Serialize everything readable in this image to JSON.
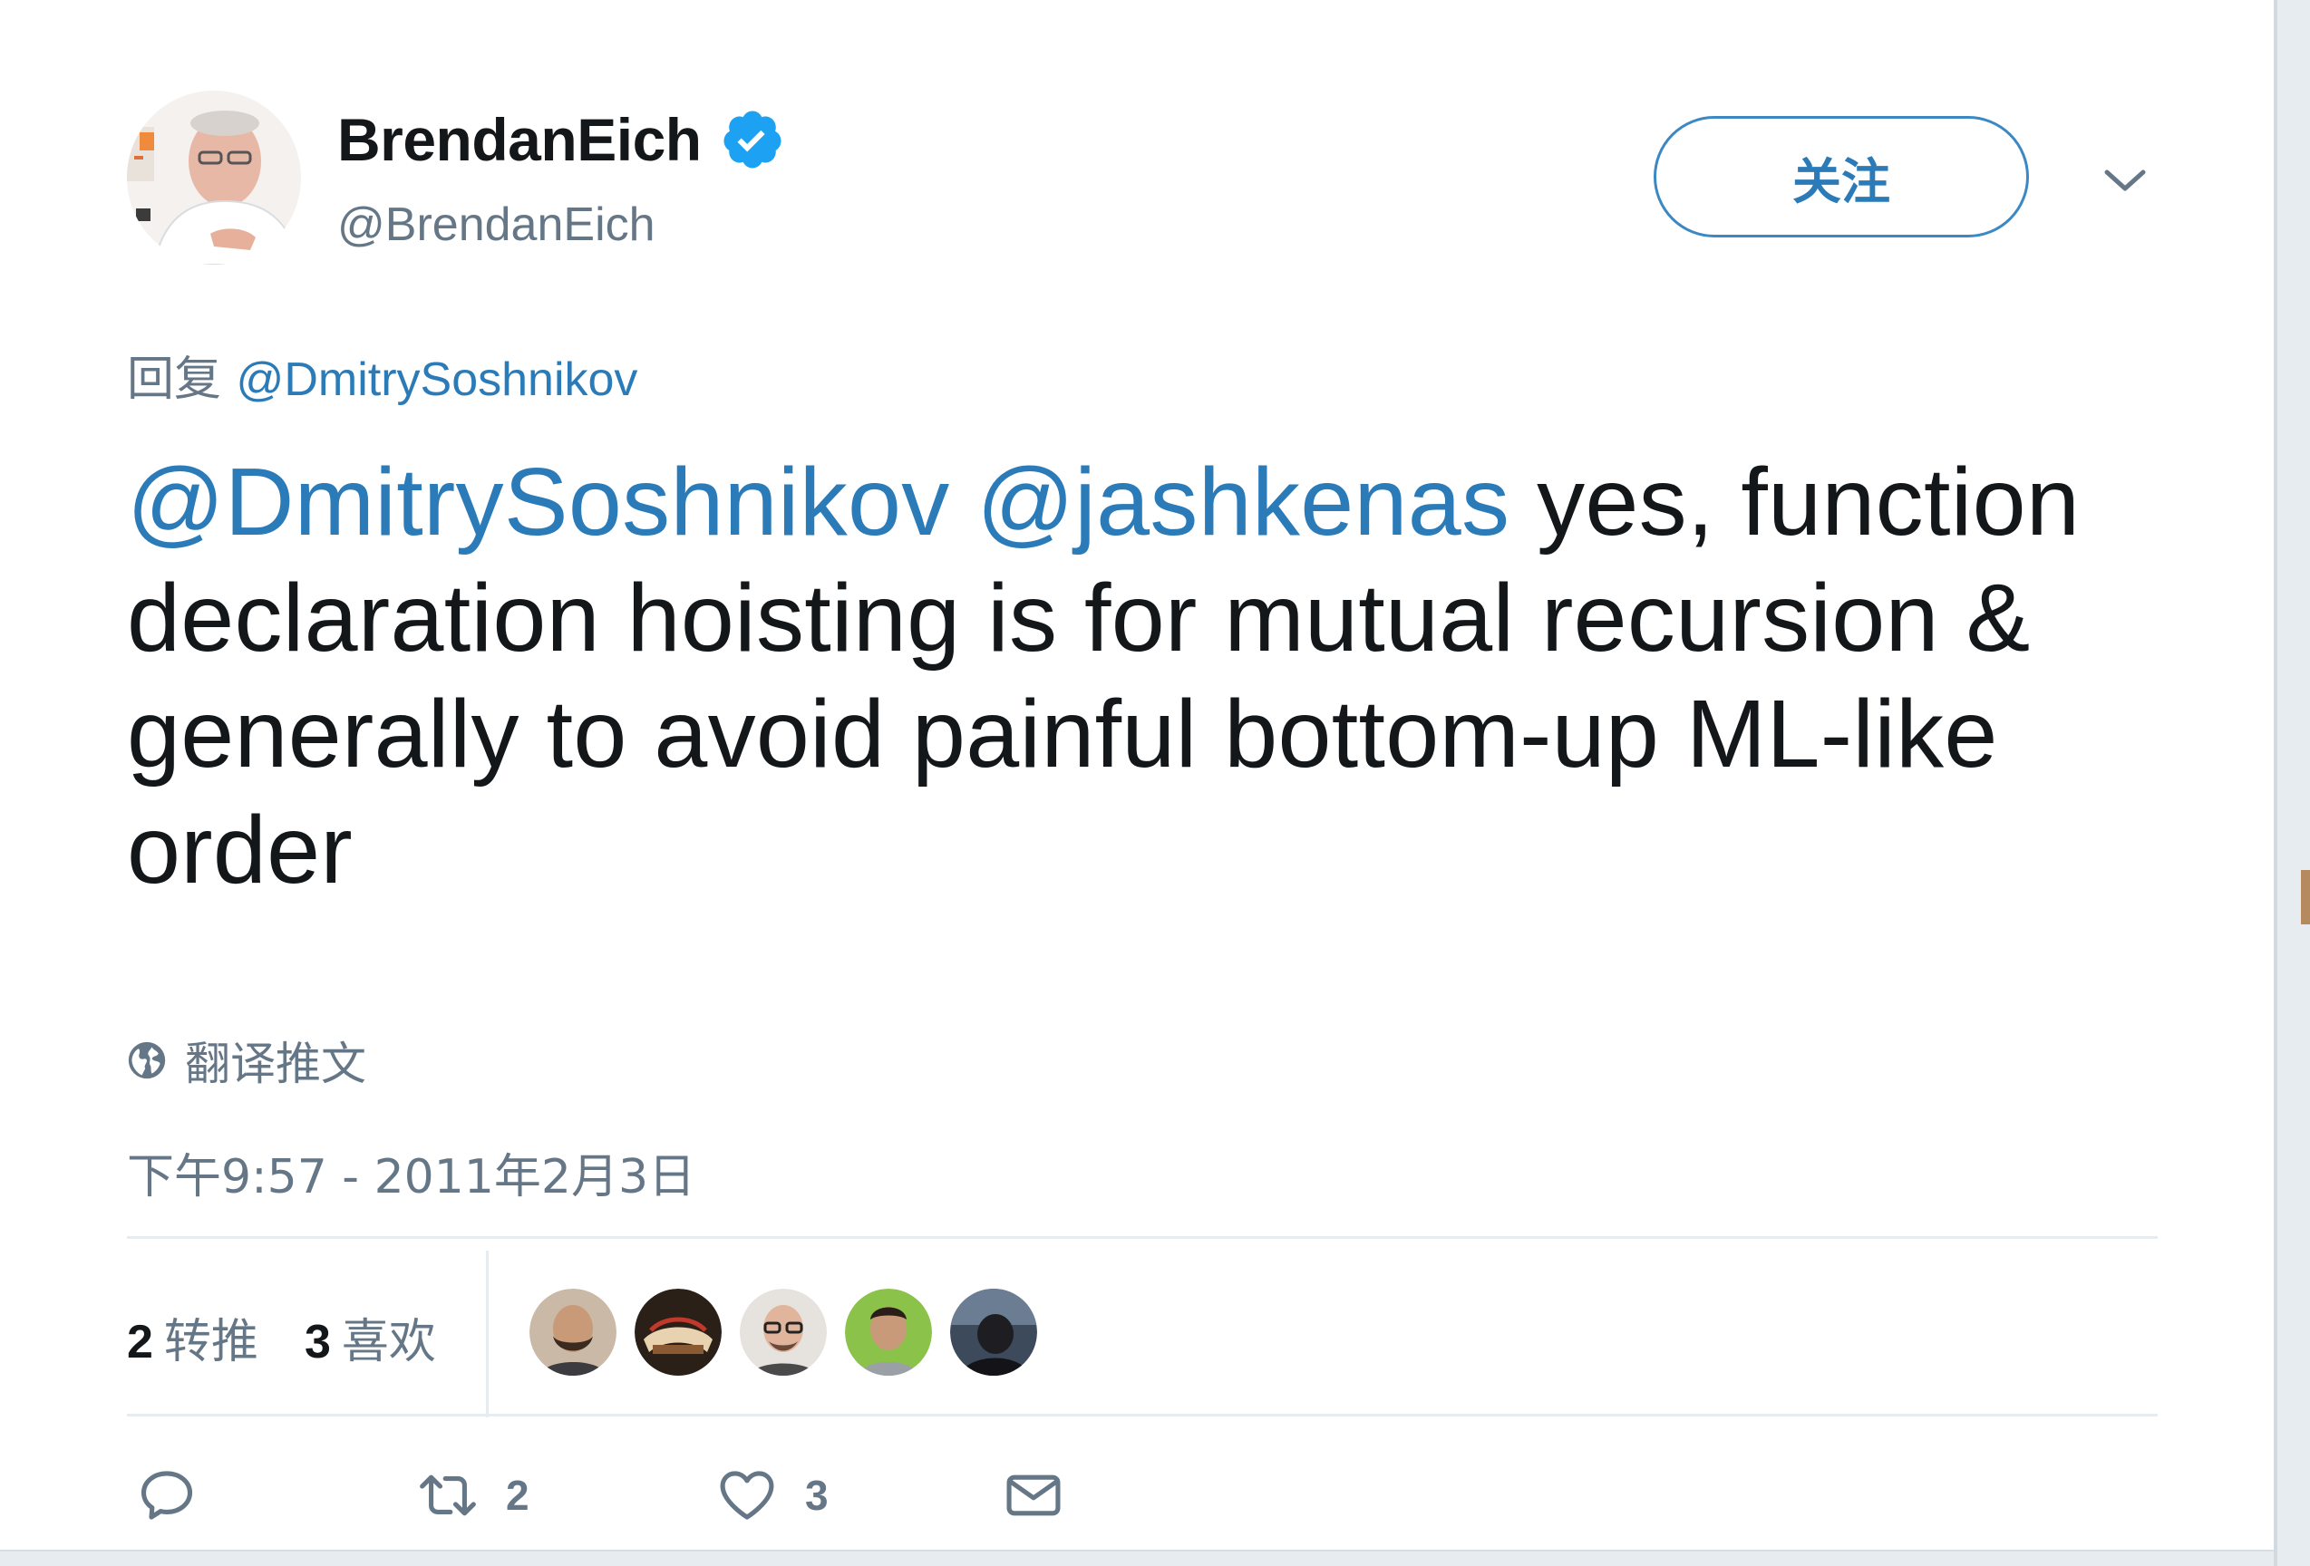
{
  "user": {
    "name": "BrendanEich",
    "handle": "@BrendanEich",
    "verified_icon": "verified-badge-icon"
  },
  "follow_button": {
    "label": "关注"
  },
  "menu": {
    "icon": "chevron-down-icon"
  },
  "reply": {
    "prefix": "回复",
    "mention": "@DmitrySoshnikov"
  },
  "tweet": {
    "mention_1": "@DmitrySoshnikov",
    "mention_2": "@jashkenas",
    "body": "yes, function declaration hoisting is for mutual recursion & generally to avoid painful bottom-up ML-like order"
  },
  "translate": {
    "icon": "globe-icon",
    "label": "翻译推文"
  },
  "timestamp": "下午9:57 - 2011年2月3日",
  "stats": {
    "retweets_count": "2",
    "retweets_label": "转推",
    "likes_count": "3",
    "likes_label": "喜欢"
  },
  "likers": [
    {
      "name": "liker-avatar-1",
      "color": "#b08a6a"
    },
    {
      "name": "liker-avatar-2",
      "color": "#6b4a32"
    },
    {
      "name": "liker-avatar-3",
      "color": "#d9d2cc"
    },
    {
      "name": "liker-avatar-4",
      "color": "#8bc34a"
    },
    {
      "name": "liker-avatar-5",
      "color": "#2e3a4a"
    }
  ],
  "actions": {
    "reply_icon": "reply-icon",
    "retweet_icon": "retweet-icon",
    "retweet_count": "2",
    "like_icon": "heart-icon",
    "like_count": "3",
    "message_icon": "envelope-icon"
  },
  "colors": {
    "link": "#2b7bb9",
    "secondary_text": "#657786",
    "primary_text": "#14171a",
    "divider": "#e6ecf0",
    "verified": "#1da1f2"
  }
}
